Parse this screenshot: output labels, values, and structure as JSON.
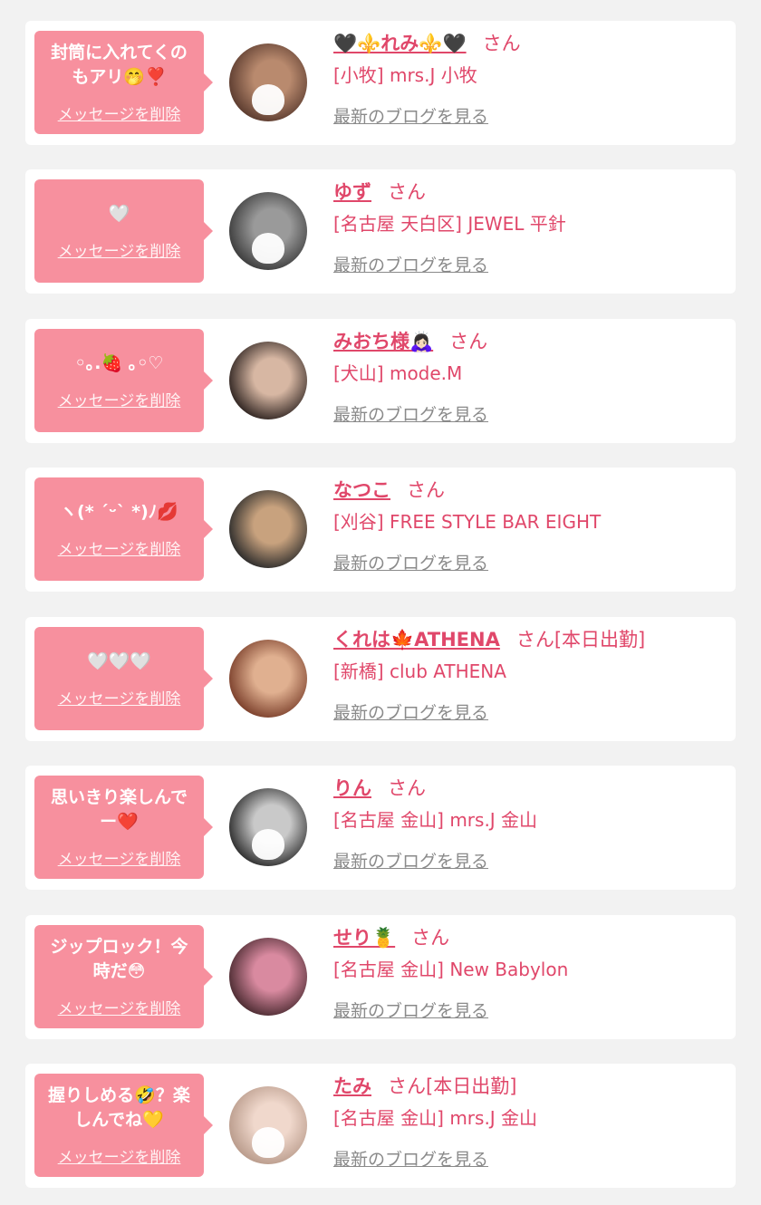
{
  "colors": {
    "background": "#f2f2f2",
    "card": "#ffffff",
    "bubble": "#f7909e",
    "accent": "#e0476a",
    "link_gray": "#8a8a8a"
  },
  "labels": {
    "delete": "メッセージを削除",
    "blog": "最新のブログを見る"
  },
  "entries": [
    {
      "message": "封筒に入れてくの\nもアリ🤭❣️",
      "name": "🖤⚜️れみ⚜️🖤",
      "suffix": "さん",
      "shop": "[小牧] mrs.J 小牧",
      "avatar_colors": [
        "#5a3a2e",
        "#b98a6e"
      ],
      "masked": true
    },
    {
      "message": "🤍",
      "name": "ゆず",
      "suffix": "さん",
      "shop": "[名古屋 天白区] JEWEL 平針",
      "avatar_colors": [
        "#3b3b3b",
        "#9a9a9a"
      ],
      "masked": true
    },
    {
      "message": "◦｡.🍓 ｡◦♡",
      "name": "みおち様🙇🏻‍♀️",
      "suffix": "さん",
      "shop": "[犬山] mode.M",
      "avatar_colors": [
        "#2e2320",
        "#d7b7a3"
      ],
      "masked": false
    },
    {
      "message": "ヽ(* ˊᵕˋ *)ﾉ💋",
      "name": "なつこ",
      "suffix": "さん",
      "shop": "[刈谷] FREE STYLE BAR EIGHT",
      "avatar_colors": [
        "#2a2a2a",
        "#c8a27e"
      ],
      "masked": false
    },
    {
      "message": "🤍🤍🤍",
      "name": "くれは🍁ATHENA",
      "suffix": "さん[本日出勤]",
      "shop": "[新橋] club ATHENA",
      "avatar_colors": [
        "#7a3e2a",
        "#e0b090"
      ],
      "masked": false
    },
    {
      "message": "思いきり楽しんで\nー❤️",
      "name": "りん",
      "suffix": "さん",
      "shop": "[名古屋 金山] mrs.J 金山",
      "avatar_colors": [
        "#2c2c2c",
        "#c9c9c9"
      ],
      "masked": true
    },
    {
      "message": "ジップロック！今\n時だ😳",
      "name": "せり🍍",
      "suffix": "さん",
      "shop": "[名古屋 金山] New Babylon",
      "avatar_colors": [
        "#4a2a30",
        "#d98aa0"
      ],
      "masked": false
    },
    {
      "message": "握りしめる🤣？楽\nしんでね💛",
      "name": "たみ",
      "suffix": "さん[本日出勤]",
      "shop": "[名古屋 金山] mrs.J 金山",
      "avatar_colors": [
        "#b89a8a",
        "#f0d8cc"
      ],
      "masked": true
    }
  ]
}
